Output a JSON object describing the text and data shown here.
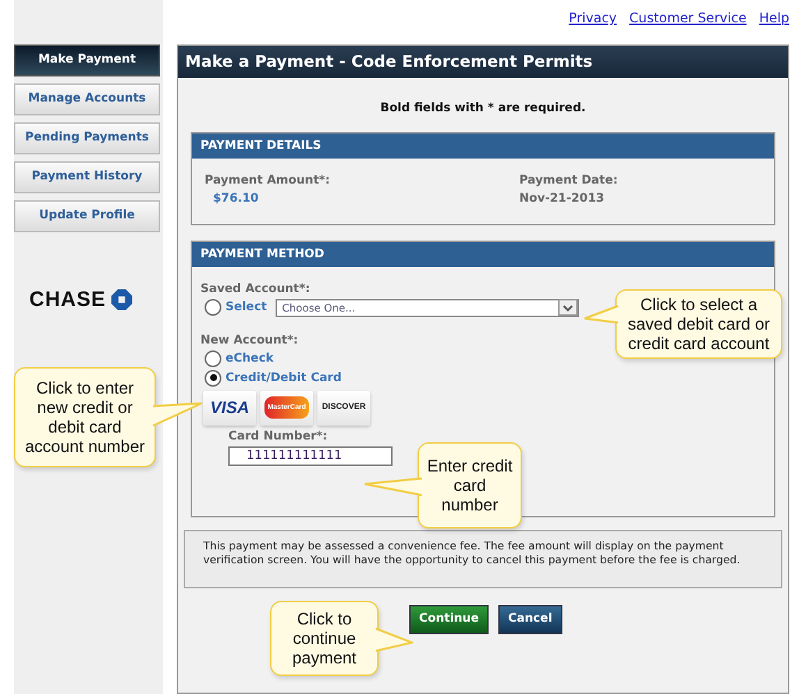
{
  "top_links": [
    "Privacy",
    "Customer Service",
    "Help"
  ],
  "sidebar": {
    "items": [
      {
        "label": "Make Payment",
        "selected": true
      },
      {
        "label": "Manage Accounts",
        "selected": false
      },
      {
        "label": "Pending Payments",
        "selected": false
      },
      {
        "label": "Payment History",
        "selected": false
      },
      {
        "label": "Update Profile",
        "selected": false
      }
    ],
    "logo": "CHASE"
  },
  "title": "Make a Payment - Code Enforcement Permits",
  "required_note": "Bold fields with * are required.",
  "payment_details": {
    "heading": "PAYMENT DETAILS",
    "fields": [
      {
        "label": "Payment Amount*:",
        "value": "$76.10",
        "kind": "link"
      },
      {
        "label": "Payment Date:",
        "value": "Nov-21-2013",
        "kind": "plain"
      }
    ]
  },
  "payment_method": {
    "heading": "PAYMENT METHOD",
    "saved_label": "Saved Account*:",
    "saved_option": {
      "label": "Select",
      "selected": false
    },
    "saved_dropdown": {
      "placeholder": "Choose One..."
    },
    "new_label": "New Account*:",
    "new_options": [
      {
        "label": "eCheck",
        "selected": false
      },
      {
        "label": "Credit/Debit Card",
        "selected": true
      }
    ],
    "card_logos": [
      "VISA",
      "MasterCard",
      "DISCOVER"
    ],
    "card_number": {
      "label": "Card Number*:",
      "value": "111111111111"
    }
  },
  "notice": "This payment may be assessed a convenience fee. The fee amount will display on the payment verification screen. You will have the opportunity to cancel this payment before the fee is charged.",
  "buttons": [
    {
      "label": "Continue",
      "kind": "primary"
    },
    {
      "label": "Cancel",
      "kind": "secondary"
    }
  ],
  "callouts": [
    "Click to select a saved debit card or credit card account",
    "Click to enter new credit or debit card account number",
    "Enter credit card number",
    "Click to continue payment"
  ]
}
